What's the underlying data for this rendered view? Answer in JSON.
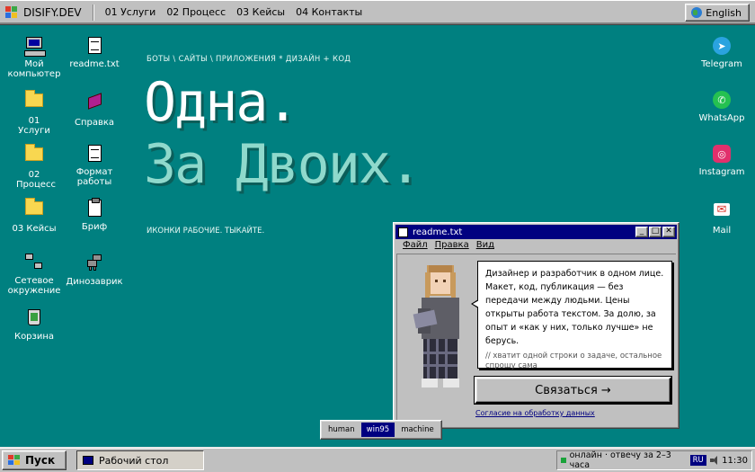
{
  "topbar": {
    "brand": "DISIFY.DEV",
    "nav": [
      "01 Услуги",
      "02 Процесс",
      "03 Кейсы",
      "04 Контакты"
    ],
    "lang": "English"
  },
  "desktop_left": [
    {
      "label": "Мой компьютер",
      "icon": "my-computer-icon"
    },
    {
      "label": "readme.txt",
      "icon": "text-file-icon"
    },
    {
      "label": "01 Услуги",
      "icon": "folder-icon"
    },
    {
      "label": "Справка",
      "icon": "help-book-icon"
    },
    {
      "label": "02 Процесс",
      "icon": "folder-icon"
    },
    {
      "label": "Формат работы",
      "icon": "document-pen-icon"
    },
    {
      "label": "03 Кейсы",
      "icon": "folder-icon"
    },
    {
      "label": "Бриф",
      "icon": "clipboard-icon"
    },
    {
      "label": "Сетевое окружение",
      "icon": "network-icon"
    },
    {
      "label": "Динозаврик",
      "icon": "dinosaur-icon"
    },
    {
      "label": "Корзина",
      "icon": "recycle-bin-icon"
    }
  ],
  "desktop_right": [
    {
      "label": "Telegram",
      "icon": "telegram-icon",
      "color": "#2aa3e0"
    },
    {
      "label": "WhatsApp",
      "icon": "whatsapp-icon",
      "color": "#25c151"
    },
    {
      "label": "Instagram",
      "icon": "instagram-icon",
      "color": "#e1306c"
    },
    {
      "label": "Mail",
      "icon": "mail-icon",
      "color": "#d93025"
    }
  ],
  "hero": {
    "kicker": "БОТЫ \\ САЙТЫ \\ ПРИЛОЖЕНИЯ * ДИЗАЙН + КОД",
    "line1": "Одна.",
    "line2": "За Двоих.",
    "note": "ИКОНКИ РАБОЧИЕ. ТЫКАЙТЕ."
  },
  "window": {
    "title": "readme.txt",
    "menu": [
      "Файл",
      "Правка",
      "Вид"
    ],
    "bubble_text": "Дизайнер и разработчик в одном лице. Макет, код, публикация — без передачи между людьми. Цены открыты работа текстом. За долю, за опыт и «как у них, только лучше» не берусь.",
    "bubble_sub": "// хватит одной строки о задаче, остальное спрошу сама",
    "cta": "Связаться →",
    "consent": "Согласие на обработку данных"
  },
  "modes": {
    "items": [
      "human",
      "win95",
      "machine"
    ],
    "active": "win95"
  },
  "taskbar": {
    "start": "Пуск",
    "task": "Рабочий стол",
    "status": "онлайн · отвечу за 2–3 часа",
    "lang": "RU",
    "time": "11:30"
  },
  "colors": {
    "desktop": "#008080",
    "titlebar": "#000080",
    "chrome": "#c0c0c0",
    "online": "#1aa33a"
  }
}
